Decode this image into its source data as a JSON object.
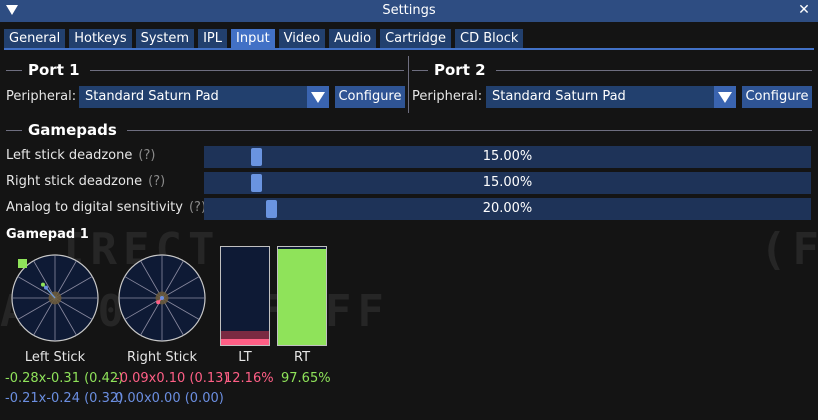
{
  "window": {
    "title": "Settings"
  },
  "tabs": [
    "General",
    "Hotkeys",
    "System",
    "IPL",
    "Input",
    "Video",
    "Audio",
    "Cartridge",
    "CD Block"
  ],
  "active_tab": "Input",
  "background_text": {
    "line1": "IRECT",
    "line2": "(F",
    "line3": "A4 02) FF FF"
  },
  "port1": {
    "heading": "Port 1",
    "peripheral_label": "Peripheral:",
    "peripheral_value": "Standard Saturn Pad",
    "configure_label": "Configure"
  },
  "port2": {
    "heading": "Port 2",
    "peripheral_label": "Peripheral:",
    "peripheral_value": "Standard Saturn Pad",
    "configure_label": "Configure"
  },
  "gamepads": {
    "heading": "Gamepads",
    "help": "(?)",
    "sliders": [
      {
        "label": "Left stick deadzone",
        "value_text": "15.00%",
        "fraction": 0.15
      },
      {
        "label": "Right stick deadzone",
        "value_text": "15.00%",
        "fraction": 0.15
      },
      {
        "label": "Analog to digital sensitivity",
        "value_text": "20.00%",
        "fraction": 0.2
      }
    ]
  },
  "gamepad1": {
    "heading": "Gamepad 1",
    "left_stick": {
      "caption": "Left Stick",
      "raw_text": "-0.28x-0.31 (0.42)",
      "processed_text": "-0.21x-0.24 (0.32)",
      "raw": [
        -0.28,
        -0.31
      ],
      "processed": [
        -0.21,
        -0.24
      ],
      "deadzone": 0.15
    },
    "right_stick": {
      "caption": "Right Stick",
      "raw_text": "-0.09x0.10 (0.13)",
      "processed_text": "0.00x0.00 (0.00)",
      "raw": [
        -0.09,
        0.1
      ],
      "processed": [
        0.0,
        0.0
      ],
      "deadzone": 0.15
    },
    "lt": {
      "caption": "LT",
      "value_text": "12.16%",
      "fraction": 0.1216
    },
    "rt": {
      "caption": "RT",
      "value_text": "97.65%",
      "fraction": 0.9765
    }
  },
  "colors": {
    "accent": "#4271c6",
    "raw_green": "#8fe35a",
    "pink": "#ff5f86",
    "processed_blue": "#6b8ee0",
    "deadzone": "#6b5a3a"
  },
  "icons": {
    "collapse": "triangle-down-icon",
    "close": "close-icon",
    "dropdown": "chevron-down-icon"
  }
}
